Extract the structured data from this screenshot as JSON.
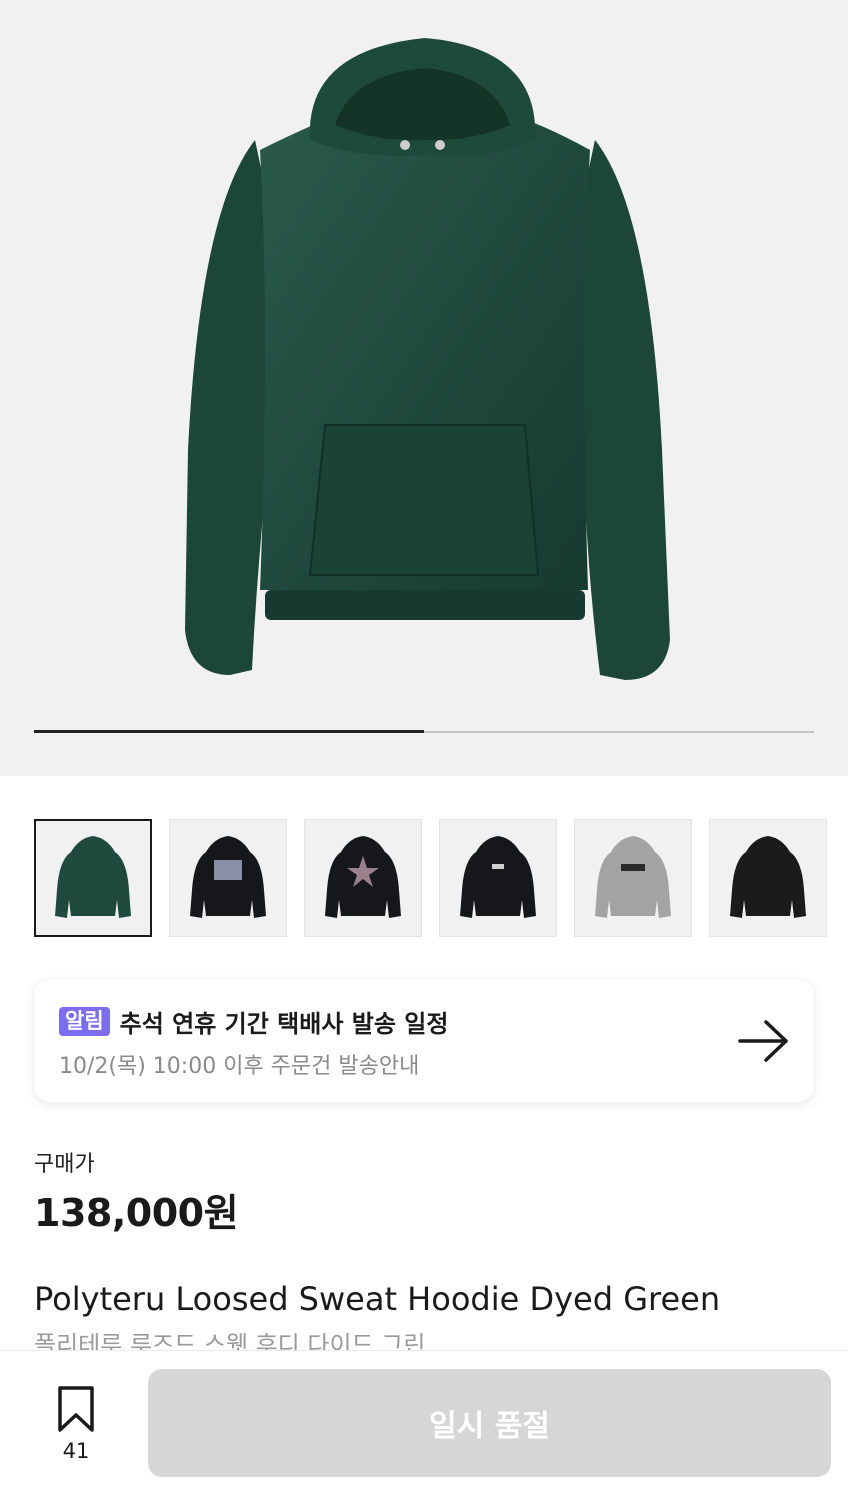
{
  "gallery": {
    "image_alt": "Polyteru Loosed Sweat Hoodie Dyed Green",
    "progress": 0.5,
    "thumbnails": [
      {
        "color": "#1f4a3d",
        "label": "thumbnail-green-hoodie",
        "selected": true
      },
      {
        "color": "#15171a",
        "label": "thumbnail-black-hoodie-print",
        "selected": false
      },
      {
        "color": "#15171a",
        "label": "thumbnail-black-hoodie-star",
        "selected": false
      },
      {
        "color": "#15171a",
        "label": "thumbnail-black-hoodie-logo",
        "selected": false
      },
      {
        "color": "#a3a3a3",
        "label": "thumbnail-gray-hoodie",
        "selected": false
      },
      {
        "color": "#1b1b1b",
        "label": "thumbnail-black-hoodie-plain",
        "selected": false
      }
    ]
  },
  "notice": {
    "badge": "알림",
    "title": "추석 연휴 기간 택배사 발송 일정",
    "subtitle": "10/2(목) 10:00 이후 주문건 발송안내",
    "arrow_icon": "arrow-right-icon"
  },
  "price": {
    "label": "구매가",
    "value": "138,000원"
  },
  "product": {
    "name_en": "Polyteru Loosed Sweat Hoodie Dyed Green",
    "name_ko": "폴리테루 루즈드 스웻 후디 다이드 그린"
  },
  "bottom": {
    "bookmark_icon": "bookmark-icon",
    "bookmark_count": "41",
    "button_label": "일시 품절"
  },
  "colors": {
    "badge": "#7c6cf0",
    "hoodie_green": "#1f4a3d",
    "button_disabled": "#d6d6d6"
  }
}
